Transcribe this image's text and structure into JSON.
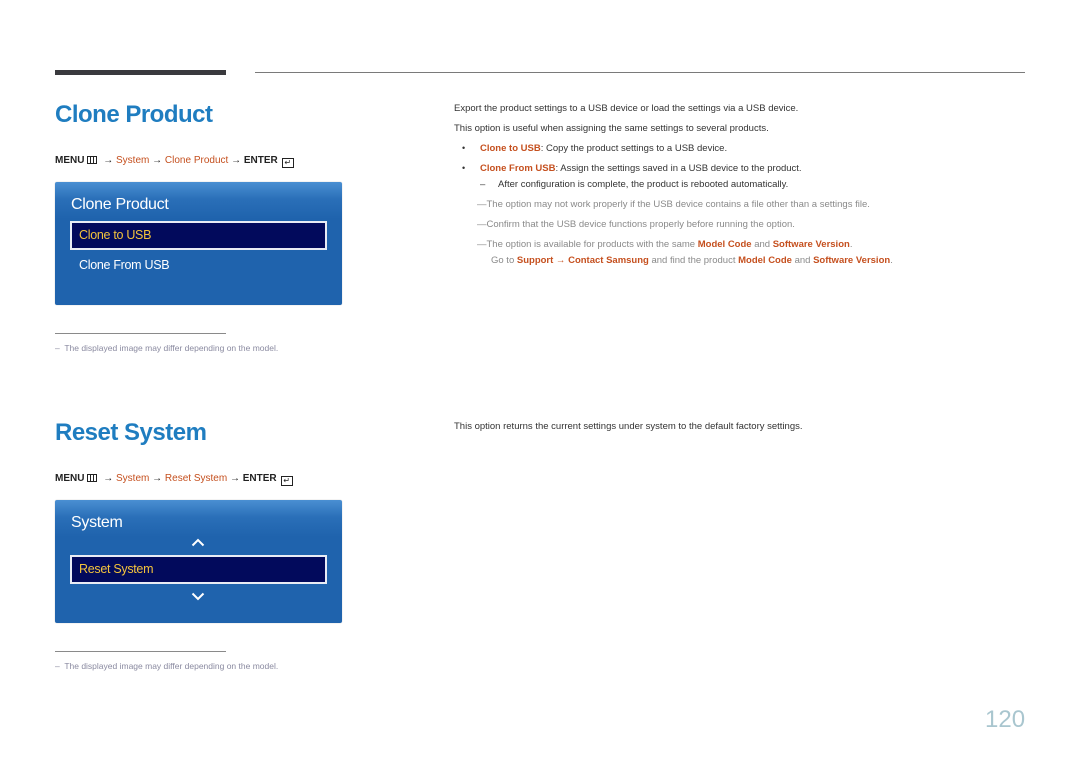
{
  "clone_product": {
    "title": "Clone Product",
    "menu_path": {
      "menu": "MENU",
      "arrow1": "→",
      "system": "System",
      "arrow2": "→",
      "item": "Clone Product",
      "arrow3": "→",
      "enter": "ENTER",
      "enter_icon": "↵"
    },
    "osd": {
      "title": "Clone Product",
      "items": [
        {
          "label": "Clone to USB",
          "selected": true
        },
        {
          "label": "Clone From USB",
          "selected": false
        }
      ]
    },
    "footnote": "The displayed image may differ depending on the model.",
    "footnote_dash": "–",
    "description": [
      "Export the product settings to a USB device or load the settings via a USB device.",
      "This option is useful when assigning the same settings to several products."
    ],
    "bullets": [
      {
        "marker": "•",
        "term": "Clone to USB",
        "text": ": Copy the product settings to a USB device."
      },
      {
        "marker": "•",
        "term": "Clone From USB",
        "text": ": Assign the settings saved in a USB device to the product."
      }
    ],
    "sub_note": {
      "dash": "–",
      "text": "After configuration is complete, the product is rebooted automatically."
    },
    "notes": [
      {
        "dash": "―",
        "text": "The option may not work properly if the USB device contains a file other than a settings file."
      },
      {
        "dash": "―",
        "text": "Confirm that the USB device functions properly before running the option."
      }
    ],
    "note3": {
      "dash": "―",
      "part1": "The option is available for products with the same ",
      "hl1": "Model Code",
      "part2": " and ",
      "hl2": "Software Version",
      "part3": ".",
      "line2_part1": "Go to ",
      "line2_hl1": "Support",
      "line2_arrow": " → ",
      "line2_hl2": "Contact Samsung",
      "line2_part2": " and find the product ",
      "line2_hl3": "Model Code",
      "line2_part3": " and ",
      "line2_hl4": "Software Version",
      "line2_part4": "."
    }
  },
  "reset_system": {
    "title": "Reset System",
    "menu_path": {
      "menu": "MENU",
      "arrow1": "→",
      "system": "System",
      "arrow2": "→",
      "item": "Reset System",
      "arrow3": "→",
      "enter": "ENTER",
      "enter_icon": "↵"
    },
    "osd": {
      "title": "System",
      "up_icon": "up-chevron",
      "selected_item": "Reset System",
      "down_icon": "down-chevron"
    },
    "footnote": "The displayed image may differ depending on the model.",
    "footnote_dash": "–",
    "description": "This option returns the current settings under system to the default factory settings."
  },
  "page_number": "120",
  "colors": {
    "heading": "#1f7dc0",
    "highlight": "#c5501f",
    "osd_bg": "#1f63ad",
    "osd_selected_bg": "#020a5c",
    "osd_selected_text": "#f3c33c"
  }
}
